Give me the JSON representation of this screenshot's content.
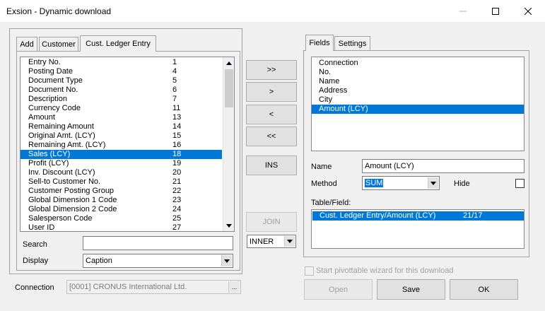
{
  "window": {
    "title": "Exsion - Dynamic download"
  },
  "left_tabs": [
    {
      "label": "Add"
    },
    {
      "label": "Customer"
    },
    {
      "label": "Cust. Ledger Entry"
    }
  ],
  "entry_list": [
    {
      "name": "Entry No.",
      "num": "1"
    },
    {
      "name": "Posting Date",
      "num": "4"
    },
    {
      "name": "Document Type",
      "num": "5"
    },
    {
      "name": "Document No.",
      "num": "6"
    },
    {
      "name": "Description",
      "num": "7"
    },
    {
      "name": "Currency Code",
      "num": "11"
    },
    {
      "name": "Amount",
      "num": "13"
    },
    {
      "name": "Remaining Amount",
      "num": "14"
    },
    {
      "name": "Original Amt. (LCY)",
      "num": "15"
    },
    {
      "name": "Remaining Amt. (LCY)",
      "num": "16"
    },
    {
      "name": "Sales (LCY)",
      "num": "18",
      "selected": true
    },
    {
      "name": "Profit (LCY)",
      "num": "19"
    },
    {
      "name": "Inv. Discount (LCY)",
      "num": "20"
    },
    {
      "name": "Sell-to Customer No.",
      "num": "21"
    },
    {
      "name": "Customer Posting Group",
      "num": "22"
    },
    {
      "name": "Global Dimension 1 Code",
      "num": "23"
    },
    {
      "name": "Global Dimension 2 Code",
      "num": "24"
    },
    {
      "name": "Salesperson Code",
      "num": "25"
    },
    {
      "name": "User ID",
      "num": "27"
    }
  ],
  "search": {
    "label": "Search",
    "value": ""
  },
  "display": {
    "label": "Display",
    "value": "Caption"
  },
  "middle_buttons": {
    "add_all": ">>",
    "add": ">",
    "remove": "<",
    "remove_all": "<<",
    "ins": "INS",
    "join": "JOIN"
  },
  "join_type": {
    "value": "INNER"
  },
  "right_tabs": [
    {
      "label": "Fields"
    },
    {
      "label": "Settings"
    }
  ],
  "fields_list": [
    {
      "label": "Connection"
    },
    {
      "label": "No."
    },
    {
      "label": "Name"
    },
    {
      "label": "Address"
    },
    {
      "label": "City"
    },
    {
      "label": "Amount (LCY)",
      "selected": true
    }
  ],
  "name_field": {
    "label": "Name",
    "value": "Amount (LCY)"
  },
  "method_field": {
    "label": "Method",
    "value": "SUM"
  },
  "hide": {
    "label": "Hide"
  },
  "table_field": {
    "label": "Table/Field:",
    "path": "Cust. Ledger Entry/Amount (LCY)",
    "ref": "21/17"
  },
  "pivot": {
    "label": "Start pivottable wizard for this download"
  },
  "connection": {
    "label": "Connection",
    "value": "[0001] CRONUS International Ltd.",
    "browse": "..."
  },
  "footer": {
    "open": "Open",
    "save": "Save",
    "ok": "OK"
  }
}
